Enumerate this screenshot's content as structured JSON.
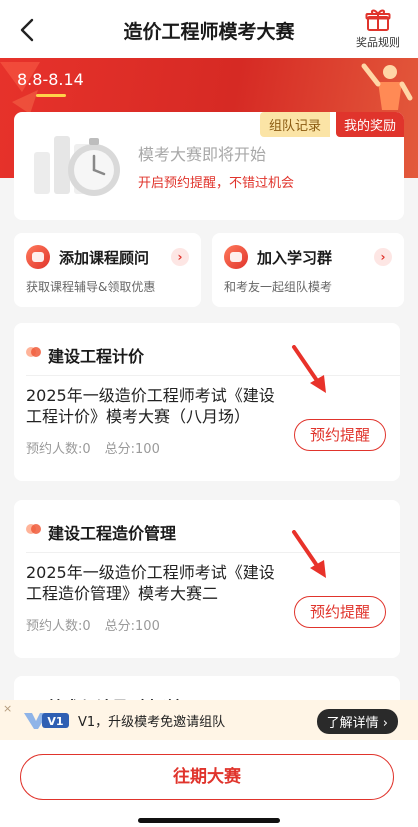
{
  "header": {
    "title": "造价工程师模考大赛",
    "rules_label": "奖品规则"
  },
  "banner": {
    "date_range": "8.8-8.14"
  },
  "reminder_card": {
    "tabs": [
      "组队记录",
      "我的奖励"
    ],
    "heading": "模考大赛即将开始",
    "subtext": "开启预约提醒，不错过机会"
  },
  "quick_cards": [
    {
      "title": "添加课程顾问",
      "desc": "获取课程辅导&领取优惠"
    },
    {
      "title": "加入学习群",
      "desc": "和考友一起组队模考"
    }
  ],
  "contests": [
    {
      "section": "建设工程计价",
      "name": "2025年一级造价工程师考试《建设工程计价》模考大赛（八月场）",
      "reservations": "预约人数:0",
      "total": "总分:100",
      "button": "预约提醒"
    },
    {
      "section": "建设工程造价管理",
      "name": "2025年一级造价工程师考试《建设工程造价管理》模考大赛二",
      "reservations": "预约人数:0",
      "total": "总分:100",
      "button": "预约提醒"
    }
  ],
  "partial_section": "技术与计量（土建）",
  "promo": {
    "close": "×",
    "badge": "V1",
    "text": "V1，升级模考免邀请组队",
    "button": "了解详情 ›"
  },
  "footer": {
    "past_button": "往期大赛"
  },
  "colors": {
    "primary_red": "#e0342c",
    "banner_red": "#d62a24",
    "tab_yellow": "#fbe4a6",
    "promo_bg": "#fff5e6"
  }
}
